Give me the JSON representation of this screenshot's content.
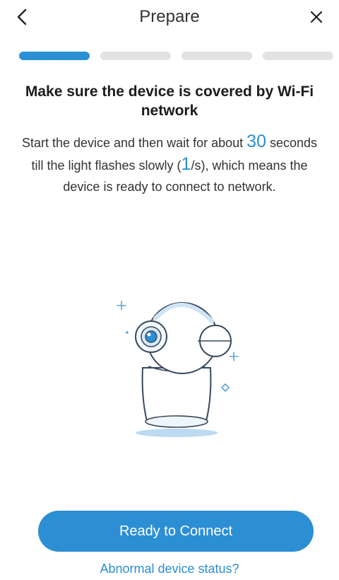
{
  "header": {
    "title": "Prepare",
    "back_icon": "chevron-left-icon",
    "close_icon": "close-icon"
  },
  "progress": {
    "current_step": 1,
    "total_steps": 4,
    "active_color": "#2a8fd3",
    "inactive_color": "#e2e2e2"
  },
  "main": {
    "headline": "Make sure the device is covered by Wi-Fi network",
    "instruction_1": "Start the device and then wait for about",
    "seconds_value": "30",
    "instruction_2": " seconds till the light flashes slowly (",
    "rate_value": "1",
    "instruction_3": "/s), which means the device is ready to connect to network.",
    "illustration_icon": "camera-device-icon"
  },
  "actions": {
    "primary_label": "Ready to Connect",
    "secondary_label": "Abnormal device status?"
  },
  "colors": {
    "accent": "#2a8fd3",
    "button": "#2c8ed3",
    "text": "#333333"
  }
}
